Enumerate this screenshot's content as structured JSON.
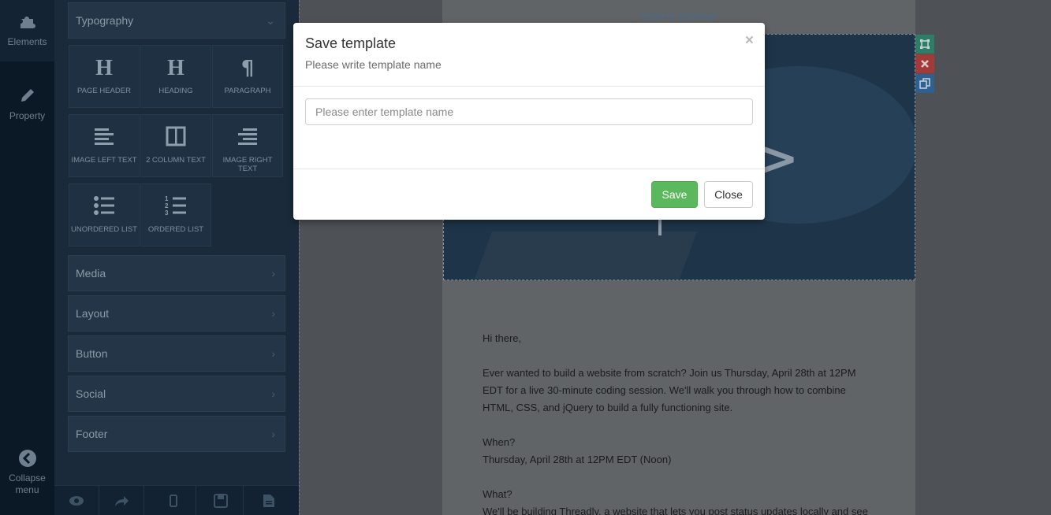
{
  "rail": {
    "elements_label": "Elements",
    "property_label": "Property",
    "collapse_label_1": "Collapse",
    "collapse_label_2": "menu"
  },
  "panel": {
    "typography": {
      "label": "Typography",
      "tiles": [
        {
          "icon": "h-icon",
          "label": "PAGE HEADER"
        },
        {
          "icon": "h-icon",
          "label": "HEADING"
        },
        {
          "icon": "paragraph-icon",
          "label": "PARAGRAPH"
        },
        {
          "icon": "align-left-icon",
          "label": "IMAGE LEFT TEXT"
        },
        {
          "icon": "columns-icon",
          "label": "2 COLUMN TEXT"
        },
        {
          "icon": "align-right-icon",
          "label": "IMAGE RIGHT TEXT"
        },
        {
          "icon": "list-ul-icon",
          "label": "UNORDERED LIST"
        },
        {
          "icon": "list-ol-icon",
          "label": "ORDERED LIST"
        }
      ]
    },
    "sections": [
      "Media",
      "Layout",
      "Button",
      "Social",
      "Footer"
    ],
    "toolbar": [
      "eye-icon",
      "share-icon",
      "mobile-icon",
      "save-icon",
      "file-icon"
    ]
  },
  "email": {
    "view_in_browser": "View in browser",
    "greeting": "Hi there,",
    "intro": "Ever wanted to build a website from scratch? Join us Thursday, April 28th at 12PM EDT for a live 30-minute coding session. We'll walk you through how to combine HTML, CSS, and jQuery to build a fully functioning site.",
    "when_label": "When?",
    "when_value": "Thursday, April 28th at 12PM EDT (Noon)",
    "what_label": "What?",
    "what_value": "We'll be building Threadly, a website that lets you post status updates locally and see"
  },
  "modal": {
    "title": "Save template",
    "subtitle": "Please write template name",
    "close_x": "×",
    "input_placeholder": "Please enter template name",
    "input_value": "",
    "save_label": "Save",
    "close_label": "Close"
  },
  "colors": {
    "save_button": "#5cb85c",
    "panel_bg": "#1a2a3a",
    "rail_bg": "#0b1826",
    "ctrl_move": "#2e7d68",
    "ctrl_delete": "#a33a3a",
    "ctrl_copy": "#2f6190"
  }
}
